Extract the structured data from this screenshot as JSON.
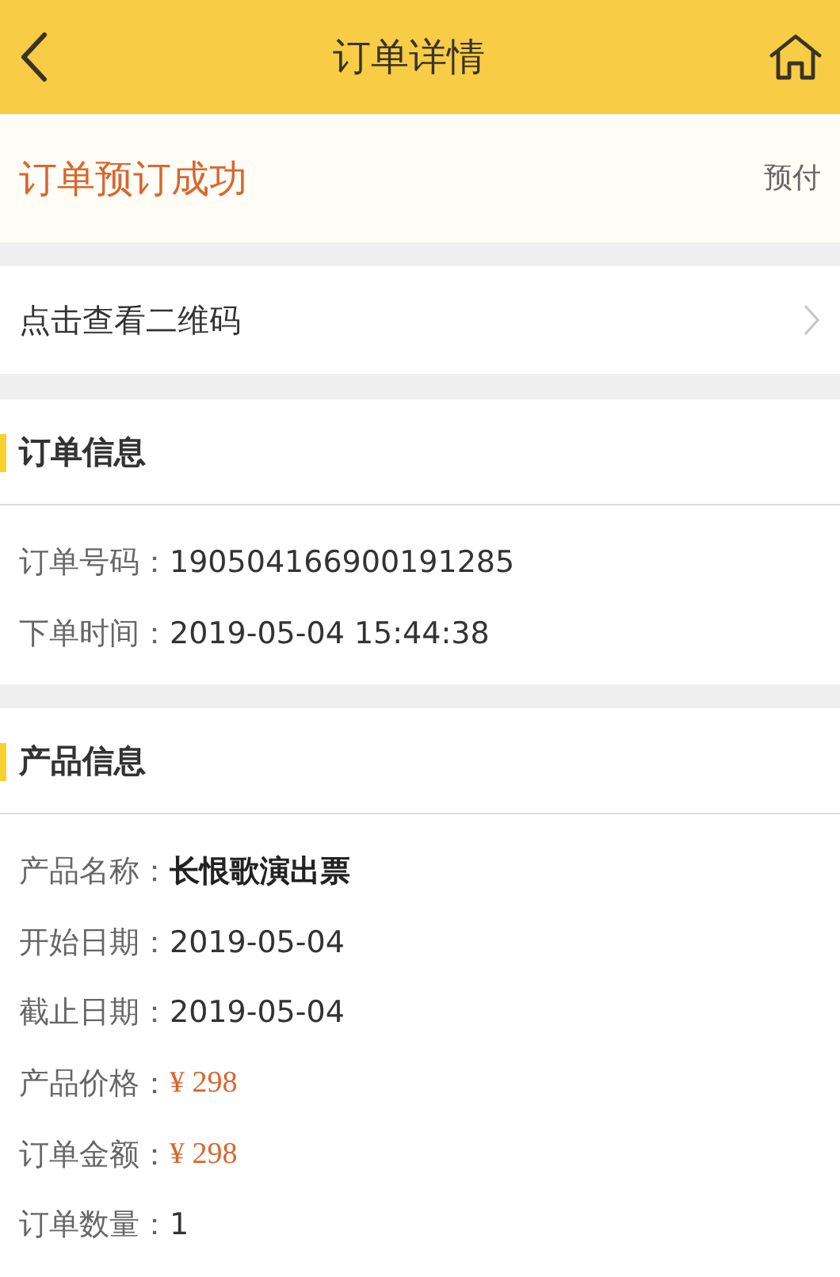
{
  "header": {
    "title": "订单详情"
  },
  "status": {
    "message": "订单预订成功",
    "payment_type": "预付"
  },
  "qr_link": {
    "label": "点击查看二维码"
  },
  "sections": [
    {
      "title": "订单信息",
      "rows": [
        {
          "label": "订单号码：",
          "value": "190504166900191285",
          "kind": "plain"
        },
        {
          "label": "下单时间：",
          "value": "2019-05-04 15:44:38",
          "kind": "plain"
        }
      ]
    },
    {
      "title": "产品信息",
      "rows": [
        {
          "label": "产品名称：",
          "value": "长恨歌演出票",
          "kind": "name"
        },
        {
          "label": "开始日期：",
          "value": "2019-05-04",
          "kind": "plain"
        },
        {
          "label": "截止日期：",
          "value": "2019-05-04",
          "kind": "plain"
        },
        {
          "label": "产品价格：",
          "value": "¥ 298",
          "kind": "price"
        },
        {
          "label": "订单金额：",
          "value": "¥ 298",
          "kind": "price"
        },
        {
          "label": "订单数量：",
          "value": "1",
          "kind": "plain"
        }
      ]
    }
  ]
}
